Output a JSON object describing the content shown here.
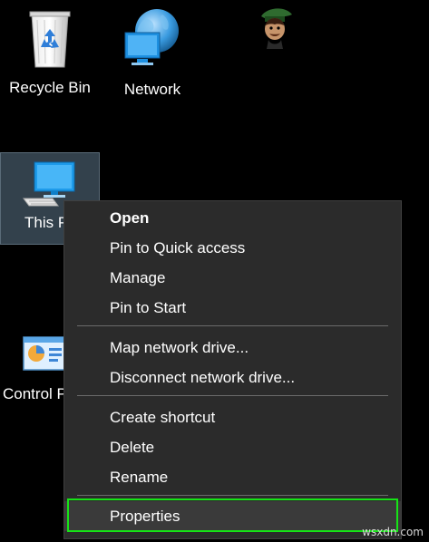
{
  "desktop": {
    "background_color": "#000000",
    "icons": {
      "recycle_bin": {
        "label": "Recycle Bin",
        "icon": "recycle-bin-icon"
      },
      "network": {
        "label": "Network",
        "icon": "network-globe-icon"
      },
      "this_pc": {
        "label": "This PC",
        "icon": "computer-icon",
        "selected": true
      },
      "control_panel": {
        "label": "Control Panel",
        "icon": "control-panel-icon"
      }
    },
    "mascot_icon": "mascot-icon"
  },
  "context_menu": {
    "items": [
      {
        "label": "Open",
        "bold": true
      },
      {
        "label": "Pin to Quick access"
      },
      {
        "label": "Manage"
      },
      {
        "label": "Pin to Start"
      },
      {
        "label": "Map network drive..."
      },
      {
        "label": "Disconnect network drive..."
      },
      {
        "label": "Create shortcut"
      },
      {
        "label": "Delete"
      },
      {
        "label": "Rename"
      },
      {
        "label": "Properties",
        "highlighted": true
      }
    ],
    "highlight_color": "#16e316"
  },
  "watermark": "wsxdn.com"
}
